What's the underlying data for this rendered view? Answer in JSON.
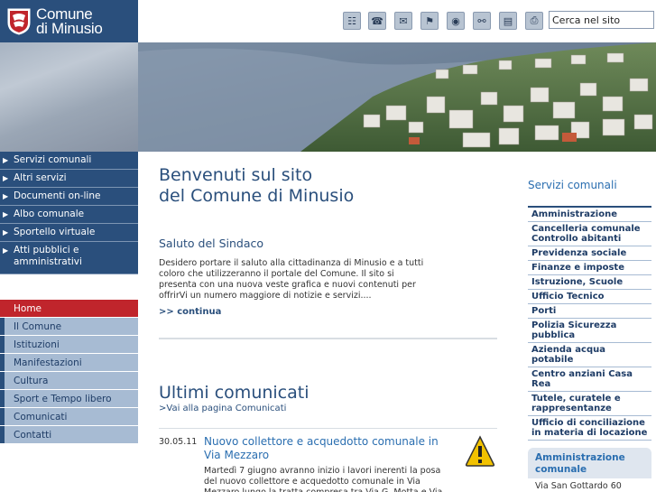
{
  "logo": {
    "line1": "Comune",
    "line2": "di Minusio"
  },
  "search": {
    "value": "Cerca nel sito"
  },
  "toolbar_icons": [
    "sitemap-icon",
    "phone-icon",
    "mail-icon",
    "map-icon",
    "camera-icon",
    "bike-icon",
    "org-chart-icon",
    "print-icon"
  ],
  "nav_services": [
    {
      "label": "Servizi comunali"
    },
    {
      "label": "Altri servizi"
    },
    {
      "label": "Documenti on-line"
    },
    {
      "label": "Albo comunale"
    },
    {
      "label": "Sportello virtuale"
    },
    {
      "label": "Atti pubblici e amministrativi"
    }
  ],
  "nav_main": [
    {
      "label": "Home"
    },
    {
      "label": "Il Comune"
    },
    {
      "label": "Istituzioni"
    },
    {
      "label": "Manifestazioni"
    },
    {
      "label": "Cultura"
    },
    {
      "label": "Sport e Tempo libero"
    },
    {
      "label": "Comunicati"
    },
    {
      "label": "Contatti"
    }
  ],
  "main": {
    "welcome_line1": "Benvenuti sul sito",
    "welcome_line2": "del Comune di Minusio",
    "saluto_title": "Saluto del Sindaco",
    "saluto_text": "Desidero portare il saluto alla cittadinanza di Minusio e a tutti coloro che utilizzeranno il portale del Comune. Il sito si presenta con una nuova veste grafica e nuovi contenuti per offrirVi un numero maggiore di notizie e servizi....",
    "continua": ">> continua",
    "ultimi_title": "Ultimi comunicati",
    "vai_link": ">Vai alla pagina Comunicati",
    "news": {
      "date": "30.05.11",
      "title": "Nuovo collettore e acquedotto comunale in Via Mezzaro",
      "text": "Martedì 7 giugno avranno inizio i lavori inerenti la posa del nuovo collettore e acquedotto comunale in Via Mezzaro lungo la tratta compresa tra Via G. Motta e Via"
    }
  },
  "right": {
    "title": "Servizi comunali",
    "items": [
      {
        "label": "Amministrazione"
      },
      {
        "label": "Cancelleria comunale Controllo abitanti"
      },
      {
        "label": "Previdenza sociale"
      },
      {
        "label": "Finanze e imposte"
      },
      {
        "label": "Istruzione, Scuole"
      },
      {
        "label": "Ufficio Tecnico"
      },
      {
        "label": "Porti"
      },
      {
        "label": "Polizia Sicurezza pubblica"
      },
      {
        "label": "Azienda acqua potabile"
      },
      {
        "label": "Centro anziani Casa Rea"
      },
      {
        "label": "Tutele, curatele e rappresentanze"
      },
      {
        "label": "Ufficio di conciliazione in materia di locazione"
      }
    ],
    "amm_title": "Amministrazione comunale",
    "amm_address": "Via San Gottardo 60"
  },
  "colors": {
    "brand": "#2a4f7c",
    "accent_red": "#c0252c",
    "link": "#2a6eb0"
  }
}
